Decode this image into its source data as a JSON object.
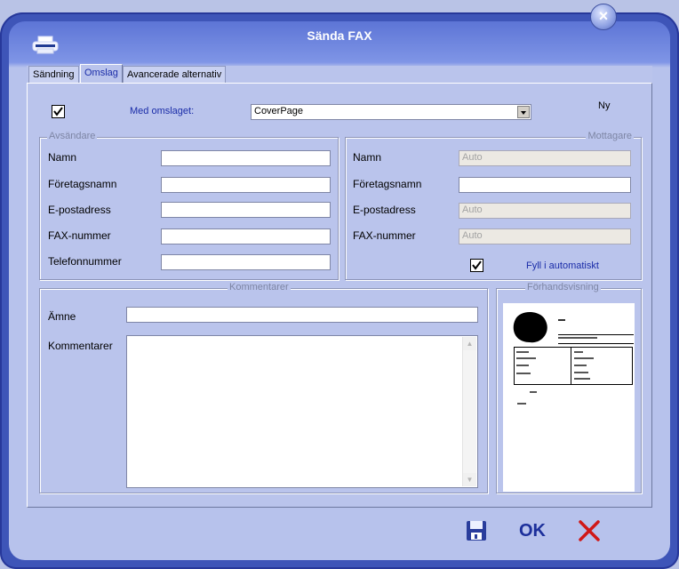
{
  "window": {
    "title": "Sända FAX"
  },
  "tabs": [
    {
      "label": "Sändning"
    },
    {
      "label": "Omslag"
    },
    {
      "label": "Avancerade alternativ"
    }
  ],
  "cover": {
    "enabled_label": "Med omslaget:",
    "selected": "CoverPage",
    "new_label": "Ny"
  },
  "sender": {
    "legend": "Avsändare",
    "name_label": "Namn",
    "company_label": "Företagsnamn",
    "email_label": "E-postadress",
    "fax_label": "FAX-nummer",
    "phone_label": "Telefonnummer",
    "name_value": "",
    "company_value": "",
    "email_value": "",
    "fax_value": "",
    "phone_value": ""
  },
  "recipient": {
    "legend": "Mottagare",
    "name_label": "Namn",
    "company_label": "Företagsnamn",
    "email_label": "E-postadress",
    "fax_label": "FAX-nummer",
    "name_value": "Auto",
    "company_value": "",
    "email_value": "Auto",
    "fax_value": "Auto",
    "autofill_label": "Fyll i automatiskt"
  },
  "comments": {
    "legend": "Kommentarer",
    "subject_label": "Ämne",
    "comments_label": "Kommentarer",
    "subject_value": "",
    "comments_value": ""
  },
  "preview": {
    "legend": "Förhandsvisning"
  },
  "footer": {
    "ok_label": "OK"
  },
  "colors": {
    "frame": "#3e55b8",
    "client": "#bac4ec",
    "accent_link": "#1a2ca8",
    "cancel": "#d01818"
  },
  "icons": {
    "app": "printer-icon",
    "close": "close-icon",
    "save": "floppy-disk-icon",
    "cancel": "cancel-x-icon"
  }
}
